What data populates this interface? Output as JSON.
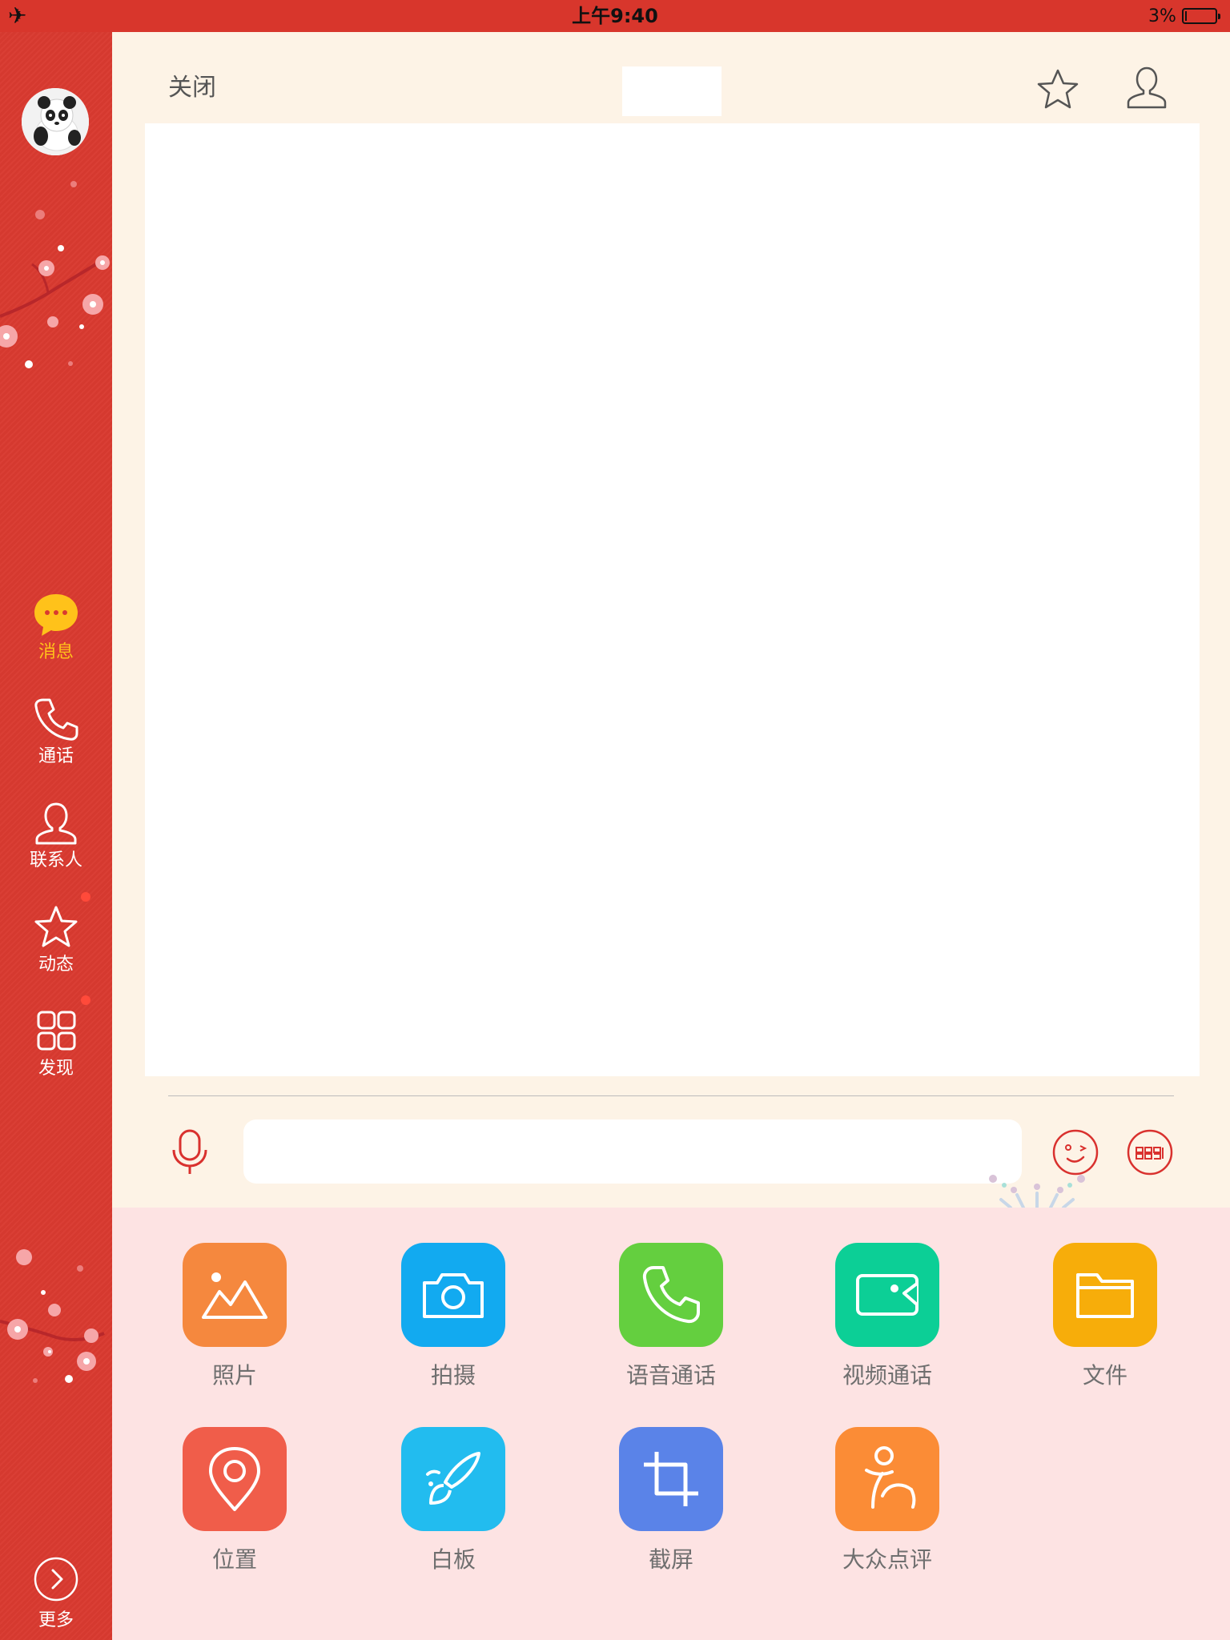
{
  "status_bar": {
    "time": "上午9:40",
    "battery_percent": "3%",
    "battery_level": 0.03,
    "airplane_icon": "airplane-icon"
  },
  "sidebar": {
    "nav": [
      {
        "label": "消息",
        "icon": "chat-bubble-icon",
        "active": true
      },
      {
        "label": "通话",
        "icon": "phone-icon",
        "active": false
      },
      {
        "label": "联系人",
        "icon": "person-icon",
        "active": false
      },
      {
        "label": "动态",
        "icon": "star-icon",
        "active": false
      },
      {
        "label": "发现",
        "icon": "grid-icon",
        "active": false
      }
    ],
    "more_label": "更多"
  },
  "topbar": {
    "close_label": "关闭",
    "title": ""
  },
  "composer": {
    "input_value": "",
    "input_placeholder": ""
  },
  "actions": [
    {
      "label": "照片",
      "icon": "photo-icon",
      "color": "#f5883e"
    },
    {
      "label": "拍摄",
      "icon": "camera-icon",
      "color": "#12aaf0"
    },
    {
      "label": "语音通话",
      "icon": "phone-icon",
      "color": "#64cf3f"
    },
    {
      "label": "视频通话",
      "icon": "video-icon",
      "color": "#0ccf96"
    },
    {
      "label": "文件",
      "icon": "folder-icon",
      "color": "#f7ad0a"
    },
    {
      "label": "位置",
      "icon": "location-pin-icon",
      "color": "#f05d4a"
    },
    {
      "label": "白板",
      "icon": "whiteboard-brush-icon",
      "color": "#22bcef"
    },
    {
      "label": "截屏",
      "icon": "crop-icon",
      "color": "#5a83e8"
    },
    {
      "label": "大众点评",
      "icon": "dianping-icon",
      "color": "#fb8c36"
    }
  ],
  "colors": {
    "sidebar_bg": "#d93a30",
    "active_nav": "#ffc21a",
    "main_bg": "#fdf3e6",
    "actions_bg": "#fde3e3"
  }
}
